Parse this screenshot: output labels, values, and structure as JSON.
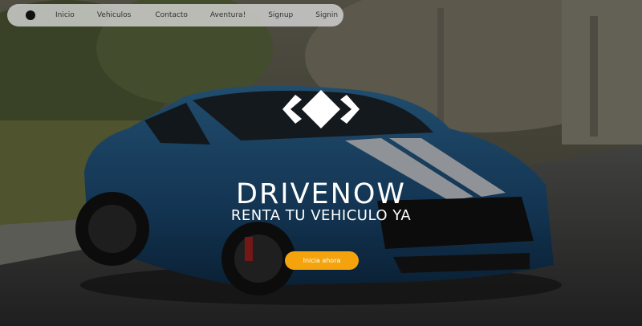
{
  "nav": {
    "links": [
      {
        "label": "Inicio"
      },
      {
        "label": "Vehiculos"
      },
      {
        "label": "Contacto"
      },
      {
        "label": "Aventura!"
      },
      {
        "label": "Signup"
      },
      {
        "label": "Signin"
      }
    ]
  },
  "hero": {
    "title": "DRIVENOW",
    "subtitle": "RENTA TU VEHICULO YA",
    "cta_label": "Inicia ahora"
  },
  "colors": {
    "accent": "#f5a30c",
    "nav_bg": "#d7d7d7",
    "car_blue": "#1c4f7a"
  },
  "icons": {
    "brand_dot": "brand-dot-icon",
    "logo": "diamond-chevrons-logo-icon"
  }
}
